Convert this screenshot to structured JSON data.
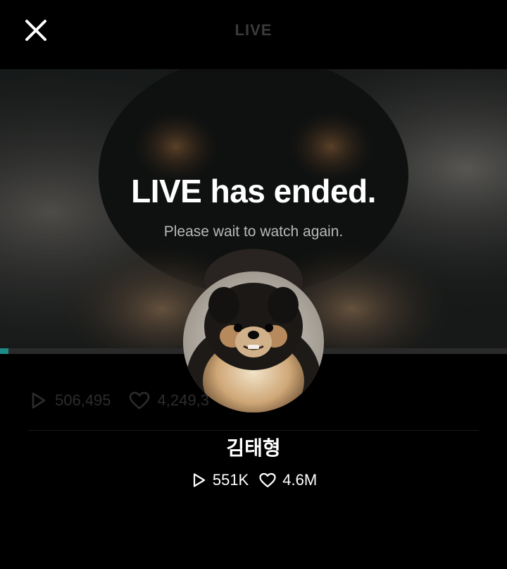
{
  "header": {
    "title": "LIVE",
    "close_icon": "close-icon"
  },
  "player": {
    "ended_title": "LIVE has ended.",
    "ended_subtitle": "Please wait to watch again.",
    "progress_fraction": 0.017,
    "accent_color": "#1d8c86"
  },
  "faded_stats": {
    "plays": "506,495",
    "likes": "4,249,3"
  },
  "channel": {
    "name": "김태형",
    "plays": "551K",
    "likes": "4.6M"
  }
}
